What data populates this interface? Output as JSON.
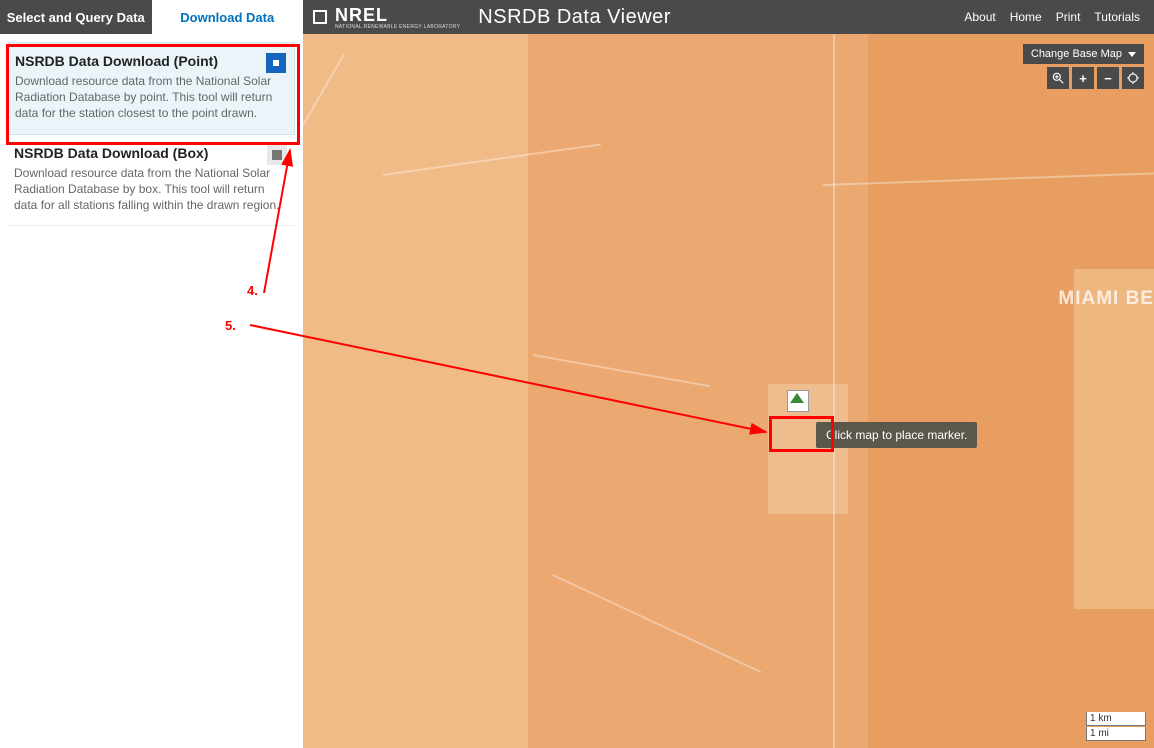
{
  "header": {
    "tabs": [
      {
        "label": "Select and Query Data",
        "active": false
      },
      {
        "label": "Download Data",
        "active": true
      }
    ],
    "logo_text": "NREL",
    "logo_subtitle": "NATIONAL RENEWABLE ENERGY LABORATORY",
    "app_title": "NSRDB Data Viewer",
    "nav": [
      "About",
      "Home",
      "Print",
      "Tutorials"
    ]
  },
  "sidebar": {
    "cards": [
      {
        "title": "NSRDB Data Download (Point)",
        "desc": "Download resource data from the National Solar Radiation Database by point. This tool will return data for the station closest to the point drawn.",
        "selected": true
      },
      {
        "title": "NSRDB Data Download (Box)",
        "desc": "Download resource data from the National Solar Radiation Database by box. This tool will return data for all stations falling within the drawn region.",
        "selected": false
      }
    ]
  },
  "map": {
    "basemap_button": "Change Base Map",
    "tooltip": "Click map to place marker.",
    "label_miami_beach": "MIAMI BE",
    "scale_km": "1 km",
    "scale_mi": "1 mi"
  },
  "annotations": {
    "step4": "4.",
    "step5": "5."
  }
}
